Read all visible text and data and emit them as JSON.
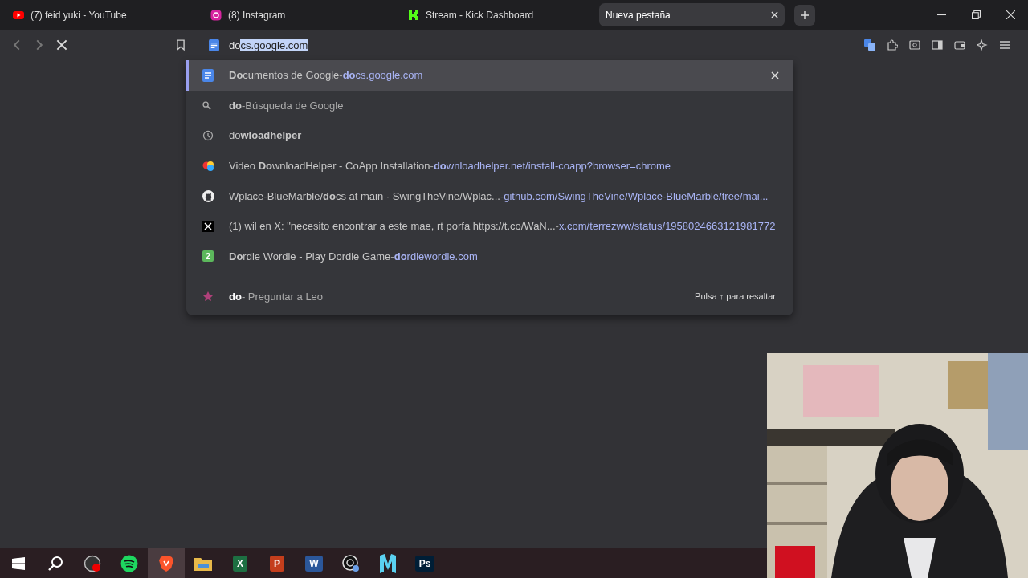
{
  "tabs": [
    {
      "label": "(7) feid yuki - YouTube",
      "kind": "youtube",
      "selected": false
    },
    {
      "label": "(8) Instagram",
      "kind": "instagram",
      "selected": false
    },
    {
      "label": "Stream - Kick Dashboard",
      "kind": "kick",
      "selected": false
    },
    {
      "label": "Nueva pestaña",
      "kind": "blank",
      "selected": true
    }
  ],
  "omnibox": {
    "typed": "do",
    "completion": "cs.google.com"
  },
  "suggestions": [
    {
      "kind": "docs",
      "title": "**Do**cumentos de Google",
      "sep": "-",
      "url": "**do**cs.google.com",
      "selected": true
    },
    {
      "kind": "search",
      "title": "**do**",
      "sep": "-",
      "detail": "Búsqueda de Google",
      "selected": false
    },
    {
      "kind": "history",
      "title": "do**wloadhelper**",
      "selected": false
    },
    {
      "kind": "colors",
      "title": "Video **Do**wnloadHelper - CoApp Installation",
      "sep": "-",
      "url": "**do**wnloadhelper.net/install-coapp?browser=chrome",
      "selected": false
    },
    {
      "kind": "github",
      "title": "Wplace-BlueMarble/**do**cs at main · SwingTheVine/Wplac...",
      "sep": "-",
      "url": "github.com/SwingTheVine/Wplace-BlueMarble/tree/mai...",
      "selected": false
    },
    {
      "kind": "x",
      "title": "(1) wil en X: \"necesito encontrar a este mae, rt porfa https://t.co/WaN...",
      "sep": "-",
      "url": "x.com/terrezww/status/1958024663121981772",
      "selected": false
    },
    {
      "kind": "dordle",
      "badge": "2",
      "title": "**Do**rdle Wordle - Play Dordle Game",
      "sep": "-",
      "url": "**do**rdlewordle.com",
      "selected": false
    }
  ],
  "leo": {
    "title": "do",
    "sep": "-",
    "detail": "Preguntar a Leo",
    "hint": "Pulsa ↑ para resaltar"
  },
  "taskbar": [
    {
      "kind": "start",
      "selected": false
    },
    {
      "kind": "search",
      "selected": false
    },
    {
      "kind": "obs",
      "selected": false
    },
    {
      "kind": "spotify",
      "selected": false
    },
    {
      "kind": "brave",
      "selected": true
    },
    {
      "kind": "folder",
      "selected": false
    },
    {
      "kind": "excel",
      "label": "X",
      "selected": false
    },
    {
      "kind": "powerpoint",
      "label": "P",
      "selected": false
    },
    {
      "kind": "word",
      "label": "W",
      "selected": false
    },
    {
      "kind": "chatgpt",
      "selected": false
    },
    {
      "kind": "filmora",
      "selected": false
    },
    {
      "kind": "photoshop",
      "label": "Ps",
      "selected": false
    }
  ]
}
